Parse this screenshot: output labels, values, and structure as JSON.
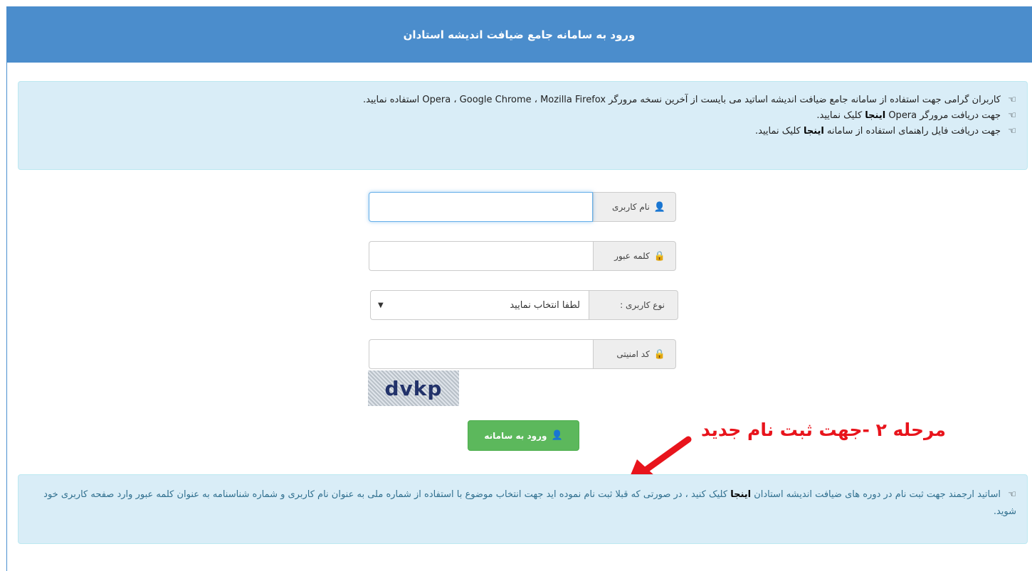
{
  "header": {
    "title": "ورود به سامانه جامع ضیافت اندیشه استادان"
  },
  "notice": {
    "icon": "hand-pointing-icon",
    "line1": "کاربران گرامی جهت استفاده از سامانه جامع ضیافت اندیشه اساتید می بایست از آخرین نسخه مرورگر Opera ، Google Chrome ، Mozilla Firefox استفاده نمایید.",
    "line2_prefix": "جهت دریافت مرورگر Opera ",
    "line2_link": "اینجا",
    "line2_suffix": " کلیک نمایید.",
    "line3_prefix": "جهت دریافت فایل راهنمای استفاده از سامانه ",
    "line3_link": "اینجا",
    "line3_suffix": " کلیک نمایید."
  },
  "form": {
    "username_label": "نام کاربری",
    "username_value": "",
    "password_label": "کلمه عبور",
    "password_value": "",
    "usertype_label": "نوع کاربری :",
    "usertype_selected": "لطفا انتخاب نمایید",
    "security_label": "کد امنیتی",
    "security_value": "",
    "captcha_text": "dvkp",
    "login_button": "ورود به سامانه",
    "icons": {
      "user": "user-icon",
      "lock": "lock-icon",
      "caret": "caret-down-icon"
    }
  },
  "register": {
    "text_prefix": "اساتید ارجمند جهت ثبت نام در دوره های ضیافت اندیشه استادان ",
    "link": "اینجا",
    "text_suffix": " کلیک کنید ، در صورتی که قبلا ثبت نام نموده اید جهت انتخاب موضوع با استفاده از شماره ملی به عنوان نام کاربری و شماره شناسنامه به عنوان کلمه عبور وارد صفحه کاربری خود شوید."
  },
  "annotation": {
    "text": "مرحله ۲ -جهت ثبت نام جدید",
    "color": "#e8141c"
  },
  "colors": {
    "header": "#4b8dcc",
    "alert_bg": "#d9edf7",
    "success": "#5cb85c"
  }
}
